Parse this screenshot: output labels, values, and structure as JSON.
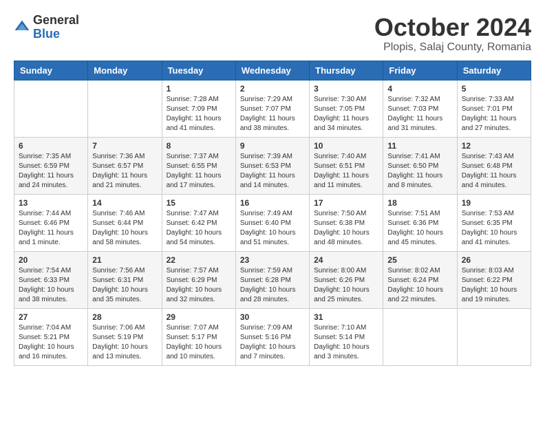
{
  "header": {
    "logo_general": "General",
    "logo_blue": "Blue",
    "month": "October 2024",
    "location": "Plopis, Salaj County, Romania"
  },
  "weekdays": [
    "Sunday",
    "Monday",
    "Tuesday",
    "Wednesday",
    "Thursday",
    "Friday",
    "Saturday"
  ],
  "weeks": [
    [
      {
        "day": "",
        "info": ""
      },
      {
        "day": "",
        "info": ""
      },
      {
        "day": "1",
        "info": "Sunrise: 7:28 AM\nSunset: 7:09 PM\nDaylight: 11 hours and 41 minutes."
      },
      {
        "day": "2",
        "info": "Sunrise: 7:29 AM\nSunset: 7:07 PM\nDaylight: 11 hours and 38 minutes."
      },
      {
        "day": "3",
        "info": "Sunrise: 7:30 AM\nSunset: 7:05 PM\nDaylight: 11 hours and 34 minutes."
      },
      {
        "day": "4",
        "info": "Sunrise: 7:32 AM\nSunset: 7:03 PM\nDaylight: 11 hours and 31 minutes."
      },
      {
        "day": "5",
        "info": "Sunrise: 7:33 AM\nSunset: 7:01 PM\nDaylight: 11 hours and 27 minutes."
      }
    ],
    [
      {
        "day": "6",
        "info": "Sunrise: 7:35 AM\nSunset: 6:59 PM\nDaylight: 11 hours and 24 minutes."
      },
      {
        "day": "7",
        "info": "Sunrise: 7:36 AM\nSunset: 6:57 PM\nDaylight: 11 hours and 21 minutes."
      },
      {
        "day": "8",
        "info": "Sunrise: 7:37 AM\nSunset: 6:55 PM\nDaylight: 11 hours and 17 minutes."
      },
      {
        "day": "9",
        "info": "Sunrise: 7:39 AM\nSunset: 6:53 PM\nDaylight: 11 hours and 14 minutes."
      },
      {
        "day": "10",
        "info": "Sunrise: 7:40 AM\nSunset: 6:51 PM\nDaylight: 11 hours and 11 minutes."
      },
      {
        "day": "11",
        "info": "Sunrise: 7:41 AM\nSunset: 6:50 PM\nDaylight: 11 hours and 8 minutes."
      },
      {
        "day": "12",
        "info": "Sunrise: 7:43 AM\nSunset: 6:48 PM\nDaylight: 11 hours and 4 minutes."
      }
    ],
    [
      {
        "day": "13",
        "info": "Sunrise: 7:44 AM\nSunset: 6:46 PM\nDaylight: 11 hours and 1 minute."
      },
      {
        "day": "14",
        "info": "Sunrise: 7:46 AM\nSunset: 6:44 PM\nDaylight: 10 hours and 58 minutes."
      },
      {
        "day": "15",
        "info": "Sunrise: 7:47 AM\nSunset: 6:42 PM\nDaylight: 10 hours and 54 minutes."
      },
      {
        "day": "16",
        "info": "Sunrise: 7:49 AM\nSunset: 6:40 PM\nDaylight: 10 hours and 51 minutes."
      },
      {
        "day": "17",
        "info": "Sunrise: 7:50 AM\nSunset: 6:38 PM\nDaylight: 10 hours and 48 minutes."
      },
      {
        "day": "18",
        "info": "Sunrise: 7:51 AM\nSunset: 6:36 PM\nDaylight: 10 hours and 45 minutes."
      },
      {
        "day": "19",
        "info": "Sunrise: 7:53 AM\nSunset: 6:35 PM\nDaylight: 10 hours and 41 minutes."
      }
    ],
    [
      {
        "day": "20",
        "info": "Sunrise: 7:54 AM\nSunset: 6:33 PM\nDaylight: 10 hours and 38 minutes."
      },
      {
        "day": "21",
        "info": "Sunrise: 7:56 AM\nSunset: 6:31 PM\nDaylight: 10 hours and 35 minutes."
      },
      {
        "day": "22",
        "info": "Sunrise: 7:57 AM\nSunset: 6:29 PM\nDaylight: 10 hours and 32 minutes."
      },
      {
        "day": "23",
        "info": "Sunrise: 7:59 AM\nSunset: 6:28 PM\nDaylight: 10 hours and 28 minutes."
      },
      {
        "day": "24",
        "info": "Sunrise: 8:00 AM\nSunset: 6:26 PM\nDaylight: 10 hours and 25 minutes."
      },
      {
        "day": "25",
        "info": "Sunrise: 8:02 AM\nSunset: 6:24 PM\nDaylight: 10 hours and 22 minutes."
      },
      {
        "day": "26",
        "info": "Sunrise: 8:03 AM\nSunset: 6:22 PM\nDaylight: 10 hours and 19 minutes."
      }
    ],
    [
      {
        "day": "27",
        "info": "Sunrise: 7:04 AM\nSunset: 5:21 PM\nDaylight: 10 hours and 16 minutes."
      },
      {
        "day": "28",
        "info": "Sunrise: 7:06 AM\nSunset: 5:19 PM\nDaylight: 10 hours and 13 minutes."
      },
      {
        "day": "29",
        "info": "Sunrise: 7:07 AM\nSunset: 5:17 PM\nDaylight: 10 hours and 10 minutes."
      },
      {
        "day": "30",
        "info": "Sunrise: 7:09 AM\nSunset: 5:16 PM\nDaylight: 10 hours and 7 minutes."
      },
      {
        "day": "31",
        "info": "Sunrise: 7:10 AM\nSunset: 5:14 PM\nDaylight: 10 hours and 3 minutes."
      },
      {
        "day": "",
        "info": ""
      },
      {
        "day": "",
        "info": ""
      }
    ]
  ]
}
